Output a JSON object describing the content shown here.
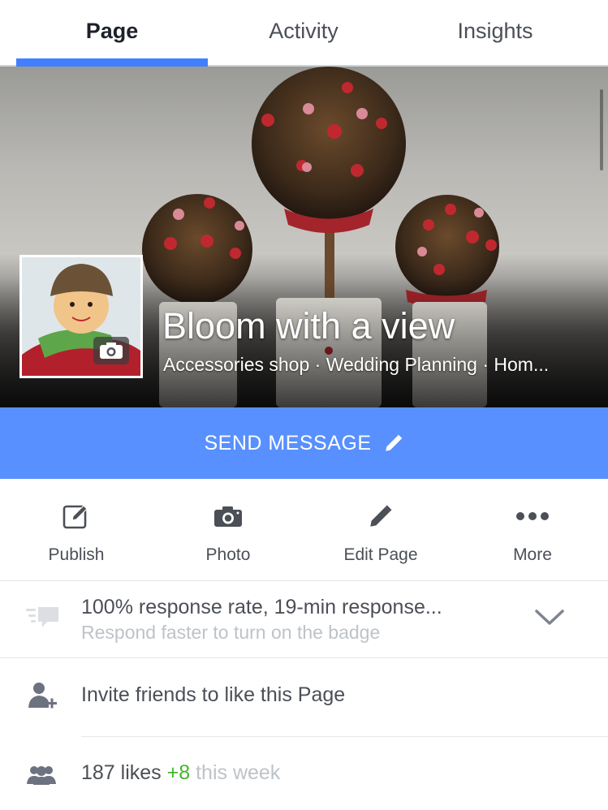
{
  "tabs": [
    {
      "label": "Page",
      "active": true
    },
    {
      "label": "Activity",
      "active": false
    },
    {
      "label": "Insights",
      "active": false
    }
  ],
  "colors": {
    "accent": "#4080ff",
    "send_button": "#5890ff",
    "positive": "#42b72a",
    "muted": "#bec3c9",
    "text": "#4b4f56"
  },
  "profile": {
    "name": "Bloom with a view",
    "categories": "Accessories shop · Wedding Planning · Hom...",
    "camera_icon": "camera-icon"
  },
  "send_message": {
    "label": "SEND MESSAGE",
    "icon": "pencil-icon"
  },
  "actions": [
    {
      "label": "Publish",
      "icon": "compose-icon"
    },
    {
      "label": "Photo",
      "icon": "camera-icon"
    },
    {
      "label": "Edit Page",
      "icon": "pencil-icon"
    },
    {
      "label": "More",
      "icon": "more-dots-icon"
    }
  ],
  "response": {
    "title": "100% response rate, 19-min response...",
    "subtitle": "Respond faster to turn on the badge",
    "icon": "chat-speed-icon"
  },
  "invite": {
    "label": "Invite friends to like this Page",
    "icon": "add-friend-icon"
  },
  "likes": {
    "count_text": "187 likes",
    "delta": "+8",
    "period": "this week",
    "icon": "people-icon"
  }
}
